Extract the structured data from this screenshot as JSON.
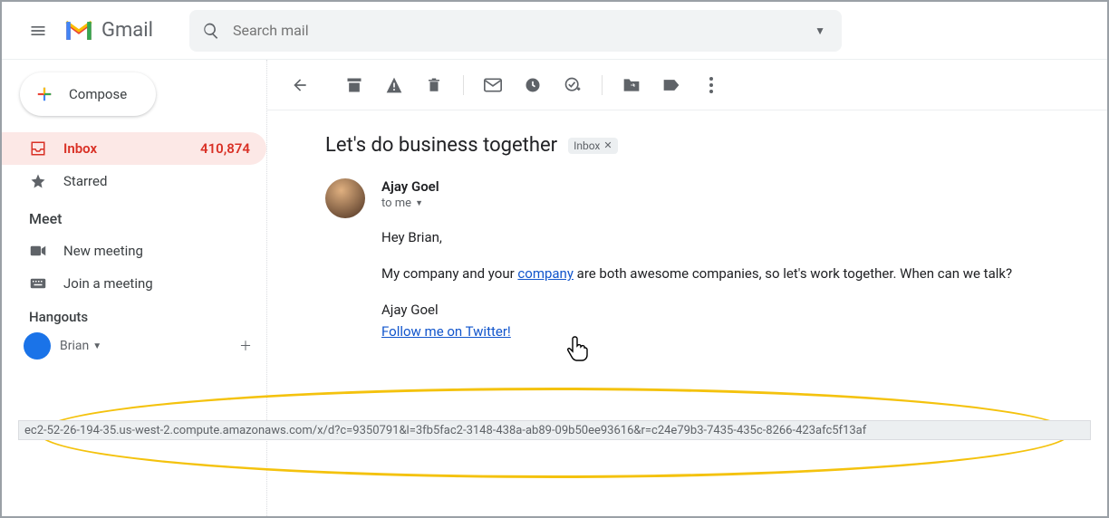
{
  "header": {
    "product": "Gmail",
    "search_placeholder": "Search mail"
  },
  "sidebar": {
    "compose_label": "Compose",
    "nav": [
      {
        "icon": "inbox",
        "label": "Inbox",
        "count": "410,874",
        "active": true
      },
      {
        "icon": "star",
        "label": "Starred"
      }
    ],
    "meet_header": "Meet",
    "meet_items": [
      {
        "icon": "camera",
        "label": "New meeting"
      },
      {
        "icon": "keyboard",
        "label": "Join a meeting"
      }
    ],
    "hangouts_header": "Hangouts",
    "hangouts_user": "Brian"
  },
  "toolbar_icons": [
    "back",
    "archive",
    "spam",
    "delete",
    "sep",
    "unread",
    "snooze",
    "tasks",
    "sep",
    "move",
    "label",
    "more"
  ],
  "email": {
    "subject": "Let's do business together",
    "label_chip": "Inbox",
    "sender_name": "Ajay Goel",
    "to_line": "to me",
    "greeting": "Hey Brian,",
    "body_before": "My company and your ",
    "body_link": "company",
    "body_after": " are both awesome companies, so let's work together. When can we talk?",
    "signature": "Ajay Goel",
    "twitter_link": "Follow me on Twitter!"
  },
  "status_url": "ec2-52-26-194-35.us-west-2.compute.amazonaws.com/x/d?c=9350791&l=3fb5fac2-3148-438a-ab89-09b50ee93616&r=c24e79b3-7435-435c-8266-423afc5f13af"
}
